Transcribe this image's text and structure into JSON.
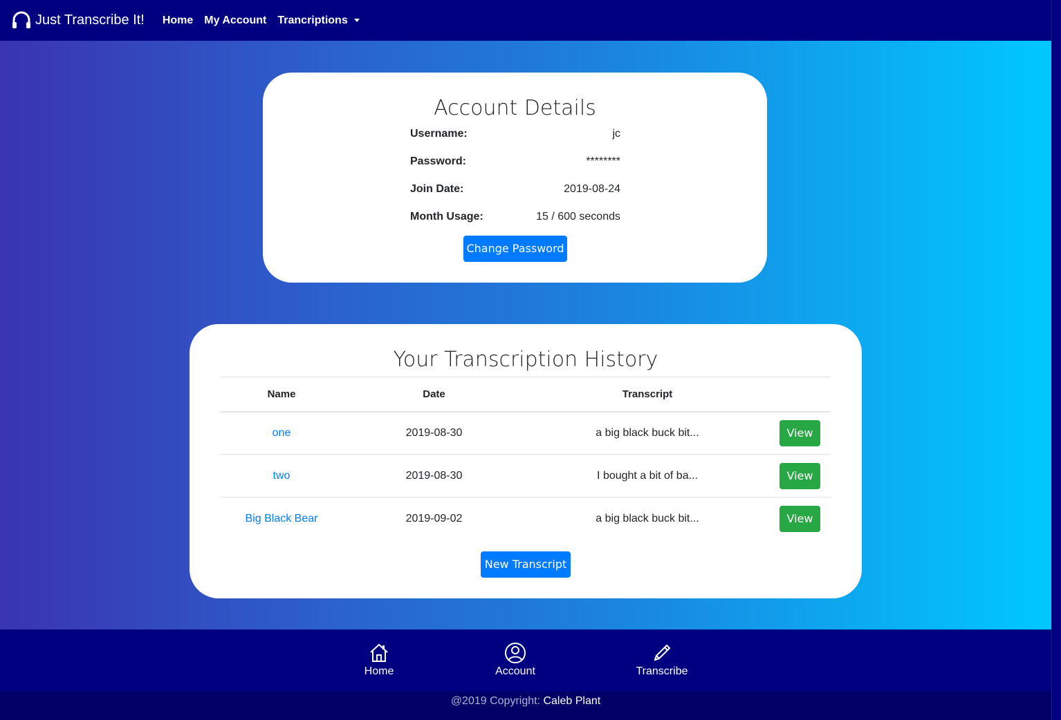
{
  "navbar": {
    "brand": "Just Transcribe It!",
    "links": [
      "Home",
      "My Account",
      "Trancriptions"
    ]
  },
  "account": {
    "title": "Account Details",
    "rows": [
      {
        "label": "Username:",
        "value": "jc"
      },
      {
        "label": "Password:",
        "value": "********"
      },
      {
        "label": "Join Date:",
        "value": "2019-08-24"
      },
      {
        "label": "Month Usage:",
        "value": "15 / 600 seconds"
      }
    ],
    "change_password": "Change Password"
  },
  "history": {
    "title": "Your Transcription History",
    "headers": [
      "Name",
      "Date",
      "Transcript"
    ],
    "rows": [
      {
        "name": "one",
        "date": "2019-08-30",
        "transcript": "a big black buck bit...",
        "action": "View"
      },
      {
        "name": "two",
        "date": "2019-08-30",
        "transcript": "I bought a bit of ba...",
        "action": "View"
      },
      {
        "name": "Big Black Bear",
        "date": "2019-09-02",
        "transcript": "a big black buck bit...",
        "action": "View"
      }
    ],
    "new_transcript": "New Transcript"
  },
  "footer": {
    "items": [
      {
        "label": "Home",
        "icon": "house-icon"
      },
      {
        "label": "Account",
        "icon": "person-circle-icon"
      },
      {
        "label": "Transcribe",
        "icon": "pencil-icon"
      }
    ],
    "copyright": "@2019 Copyright:",
    "owner": "Caleb Plant"
  },
  "colors": {
    "nav": "#000080",
    "primary": "#007bff",
    "success": "#28a745",
    "gradient_start": "#3a34b0",
    "gradient_end": "#00c8ff"
  }
}
